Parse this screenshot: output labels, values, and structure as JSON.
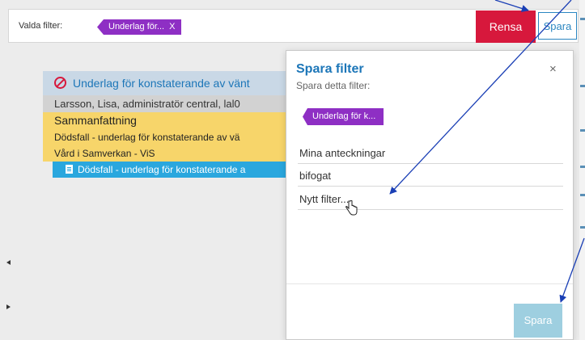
{
  "filterbar": {
    "label": "Valda filter:",
    "chip_text": "Underlag för...",
    "chip_close": "X",
    "rensa_label": "Rensa",
    "spara_label": "Spara"
  },
  "card": {
    "title": "Underlag för konstaterande av vänt",
    "user": "Larsson, Lisa, administratör central, lal0",
    "summary": "Sammanfattning",
    "row1": "Dödsfall - underlag för konstaterande av vä",
    "row2": "Vård i Samverkan - ViS",
    "link": "Dödsfall - underlag för konstaterande a"
  },
  "popover": {
    "title": "Spara filter",
    "subtitle": "Spara detta filter:",
    "close": "×",
    "chip_text": "Underlag för k...",
    "items": [
      "Mina anteckningar",
      "bifogat",
      "Nytt filter..."
    ],
    "save_label": "Spara"
  },
  "colors": {
    "accent": "#1c76b8",
    "danger": "#d7183c",
    "chip": "#8e2fc4",
    "highlight": "#f7d56a",
    "link_row": "#2aa7de"
  }
}
